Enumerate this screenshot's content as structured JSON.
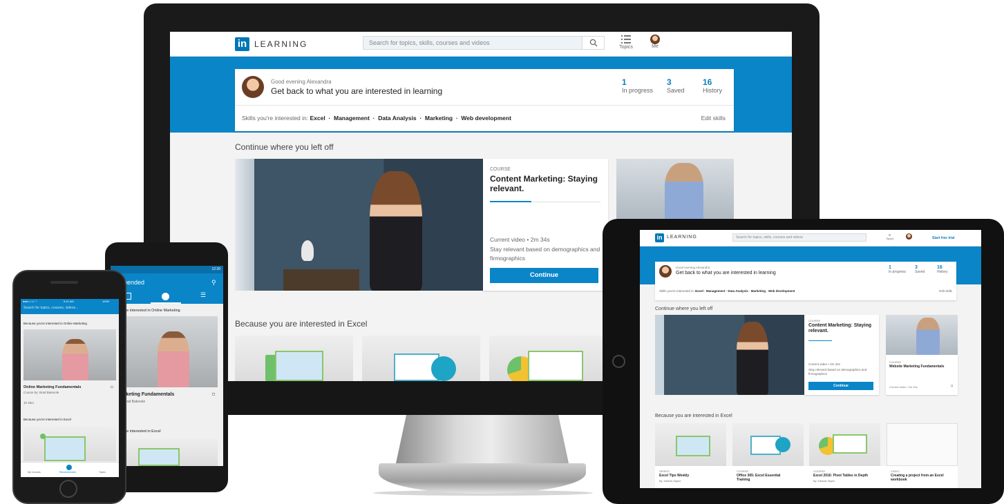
{
  "colors": {
    "brand_blue": "#0077b5",
    "header_blue": "#0a85c8",
    "stat_blue": "#0a7fc0"
  },
  "brand": {
    "logo": "in",
    "name": "LEARNING"
  },
  "search": {
    "placeholder": "Search for topics, skills, courses and videos",
    "icon": "search-icon"
  },
  "nav": {
    "topics": "Topics",
    "me": "Me",
    "trial": "Start free trial"
  },
  "welcome": {
    "greeting": "Good evening Alexandra",
    "headline": "Get back to what you are interested in learning",
    "stats": [
      {
        "n": "1",
        "label": "In progress"
      },
      {
        "n": "3",
        "label": "Saved"
      },
      {
        "n": "16",
        "label": "History"
      }
    ],
    "skills_label": "Skills you're interested in:",
    "skills": "Excel  ·  Management  ·  Data Analysis  ·  Marketing  ·  Web development",
    "edit": "Edit skills"
  },
  "continue": {
    "heading": "Continue where you left off",
    "type": "COURSE",
    "title": "Content Marketing: Staying relevant.",
    "current": "Current video • 2m 34s",
    "desc": "Stay relevant based on demographics and firmographics",
    "button": "Continue"
  },
  "side_course": {
    "type": "COURSE",
    "title": "Website Marketing Fundamentals",
    "current": "Current video • 2m 34s"
  },
  "interest": {
    "heading": "Because you are interested in Excel"
  },
  "tablet_cards": [
    {
      "type": "SERIES",
      "title": "Excel Tips Weekly",
      "author": "By: Dennis Taylor"
    },
    {
      "type": "COURSE",
      "title": "Office 365: Excel Essential Training",
      "author": ""
    },
    {
      "type": "COURSE",
      "title": "Excel 2016: Pivot Tables in Depth",
      "author": "By: Dennis Taylor"
    },
    {
      "type": "VIDEO",
      "title": "Creating a project from an Excel workbook",
      "author": ""
    }
  ],
  "android": {
    "status_time": "12:30",
    "title": "ommended",
    "reason1": "se you're interested in Online Marketing",
    "course": "e Marketing Fundamentals",
    "author": "se by: Brad Batesole",
    "reason2": "se you're interested in Excel"
  },
  "iphone": {
    "status": "●●●○○ LI  ⌔",
    "time": "9:41 AM",
    "battery": "100%",
    "search": "Search for topics, courses, videos...",
    "reason1": "Because you're interested in Online Marketing",
    "course": "Online Marketing Fundamentals",
    "author": "Course by: Brad Batesole",
    "duration": "1h 45m",
    "reason2": "Because you're interested in Excel",
    "tabs": [
      "My Courses",
      "Recommended",
      "Topics"
    ]
  }
}
